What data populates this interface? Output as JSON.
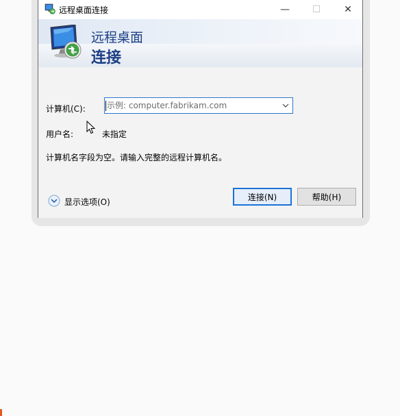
{
  "window": {
    "title": "远程桌面连接",
    "banner_line1": "远程桌面",
    "banner_line2": "连接",
    "title_buttons": {
      "minimize": "—",
      "maximize": "☐",
      "close": "✕"
    }
  },
  "form": {
    "computer_label": "计算机(C):",
    "computer_placeholder": "示例: computer.fabrikam.com",
    "computer_value": "",
    "username_label": "用户名:",
    "username_value": "未指定",
    "message": "计算机名字段为空。请输入完整的远程计算机名。"
  },
  "footer": {
    "show_options_label": "显示选项(O)",
    "connect_label": "连接(N)",
    "help_label": "帮助(H)"
  },
  "colors": {
    "accent": "#1a72d6",
    "banner_text": "#1e3f85"
  }
}
